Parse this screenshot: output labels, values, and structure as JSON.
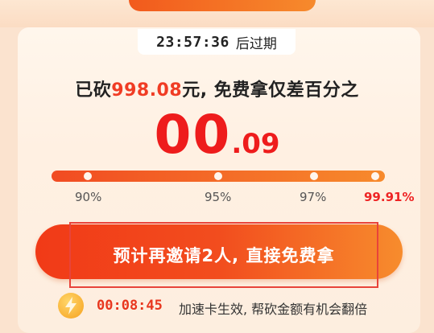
{
  "timer": {
    "time": "23:57:36",
    "suffix": "后过期"
  },
  "headline": {
    "prefix": "已砍",
    "amount": "998.08",
    "suffix": "元, 免费拿仅差百分之"
  },
  "remaining_percent": {
    "integer": "00",
    "decimal": ".09"
  },
  "progress": {
    "value": 99.91,
    "ticks": [
      "90%",
      "95%",
      "97%",
      "99.91%"
    ]
  },
  "cta": {
    "label": "预计再邀请2人, 直接免费拿"
  },
  "speedup": {
    "countdown": "00:08:45",
    "text": "加速卡生效, 帮砍金额有机会翻倍"
  },
  "colors": {
    "accent": "#ee1c1c",
    "button_start": "#f13a17",
    "button_end": "#f78c2d"
  }
}
